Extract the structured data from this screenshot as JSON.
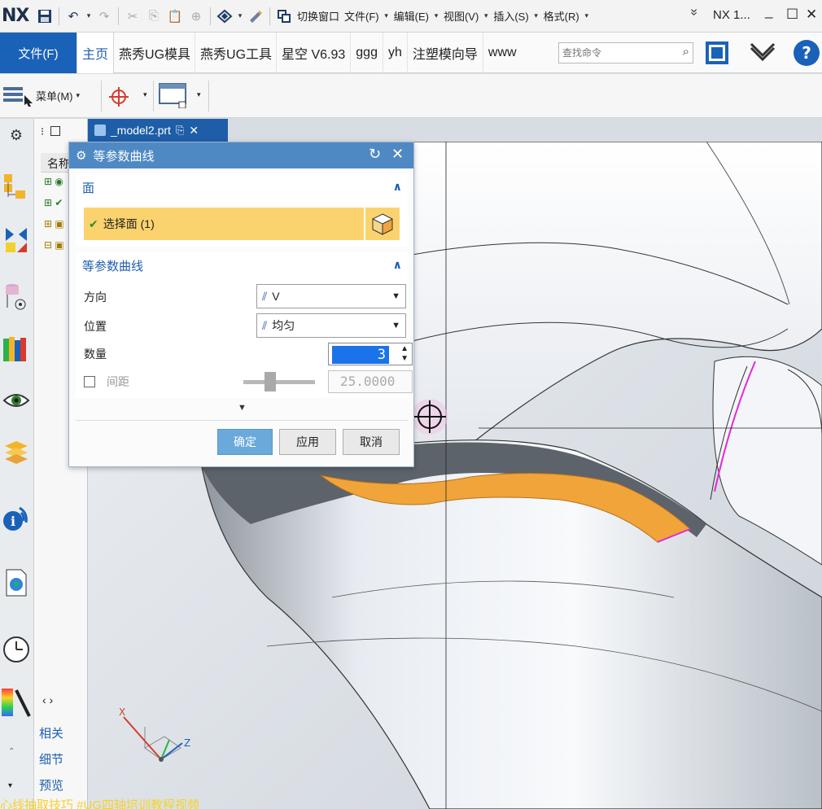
{
  "app": {
    "logo": "NX",
    "window_title": "NX 1...",
    "win_controls": {
      "min": "_",
      "max": "☐",
      "close": "✕"
    }
  },
  "titlebar": {
    "switch_window": "切换窗口",
    "menus": [
      "文件(F)",
      "编辑(E)",
      "视图(V)",
      "插入(S)",
      "格式(R)"
    ],
    "more": "»"
  },
  "ribbon": {
    "file_tab": "文件(F)",
    "tabs": [
      "主页",
      "燕秀UG模具",
      "燕秀UG工具",
      "星空 V6.93",
      "ggg",
      "yh",
      "注塑模向导",
      "www"
    ],
    "active_tab": "主页",
    "search_placeholder": "查找命令"
  },
  "toolbar": {
    "menu_label": "菜单(M)"
  },
  "navigator": {
    "column_header": "名称",
    "bottom_tabs": [
      "相关",
      "细节",
      "预览"
    ]
  },
  "part_tab": {
    "label": "_model2.prt"
  },
  "dialog": {
    "title": "等参数曲线",
    "face_group": {
      "title": "面",
      "select_label": "选择面 (1)"
    },
    "curve_group": {
      "title": "等参数曲线",
      "direction_label": "方向",
      "direction_value": "V",
      "position_label": "位置",
      "position_value": "均匀",
      "count_label": "数量",
      "count_value": "3",
      "spacing_label": "间距",
      "spacing_value": "25.0000",
      "spacing_checked": false
    },
    "buttons": {
      "ok": "确定",
      "apply": "应用",
      "cancel": "取消"
    }
  },
  "caption": "心线抽取技巧 #UG四轴培训教程视频",
  "colors": {
    "accent_blue": "#1a62b8",
    "dialog_title": "#4f89c4",
    "selection_yellow": "#fbd36e",
    "highlight_orange": "#f0a43a",
    "curve_magenta": "#e22ad8"
  }
}
